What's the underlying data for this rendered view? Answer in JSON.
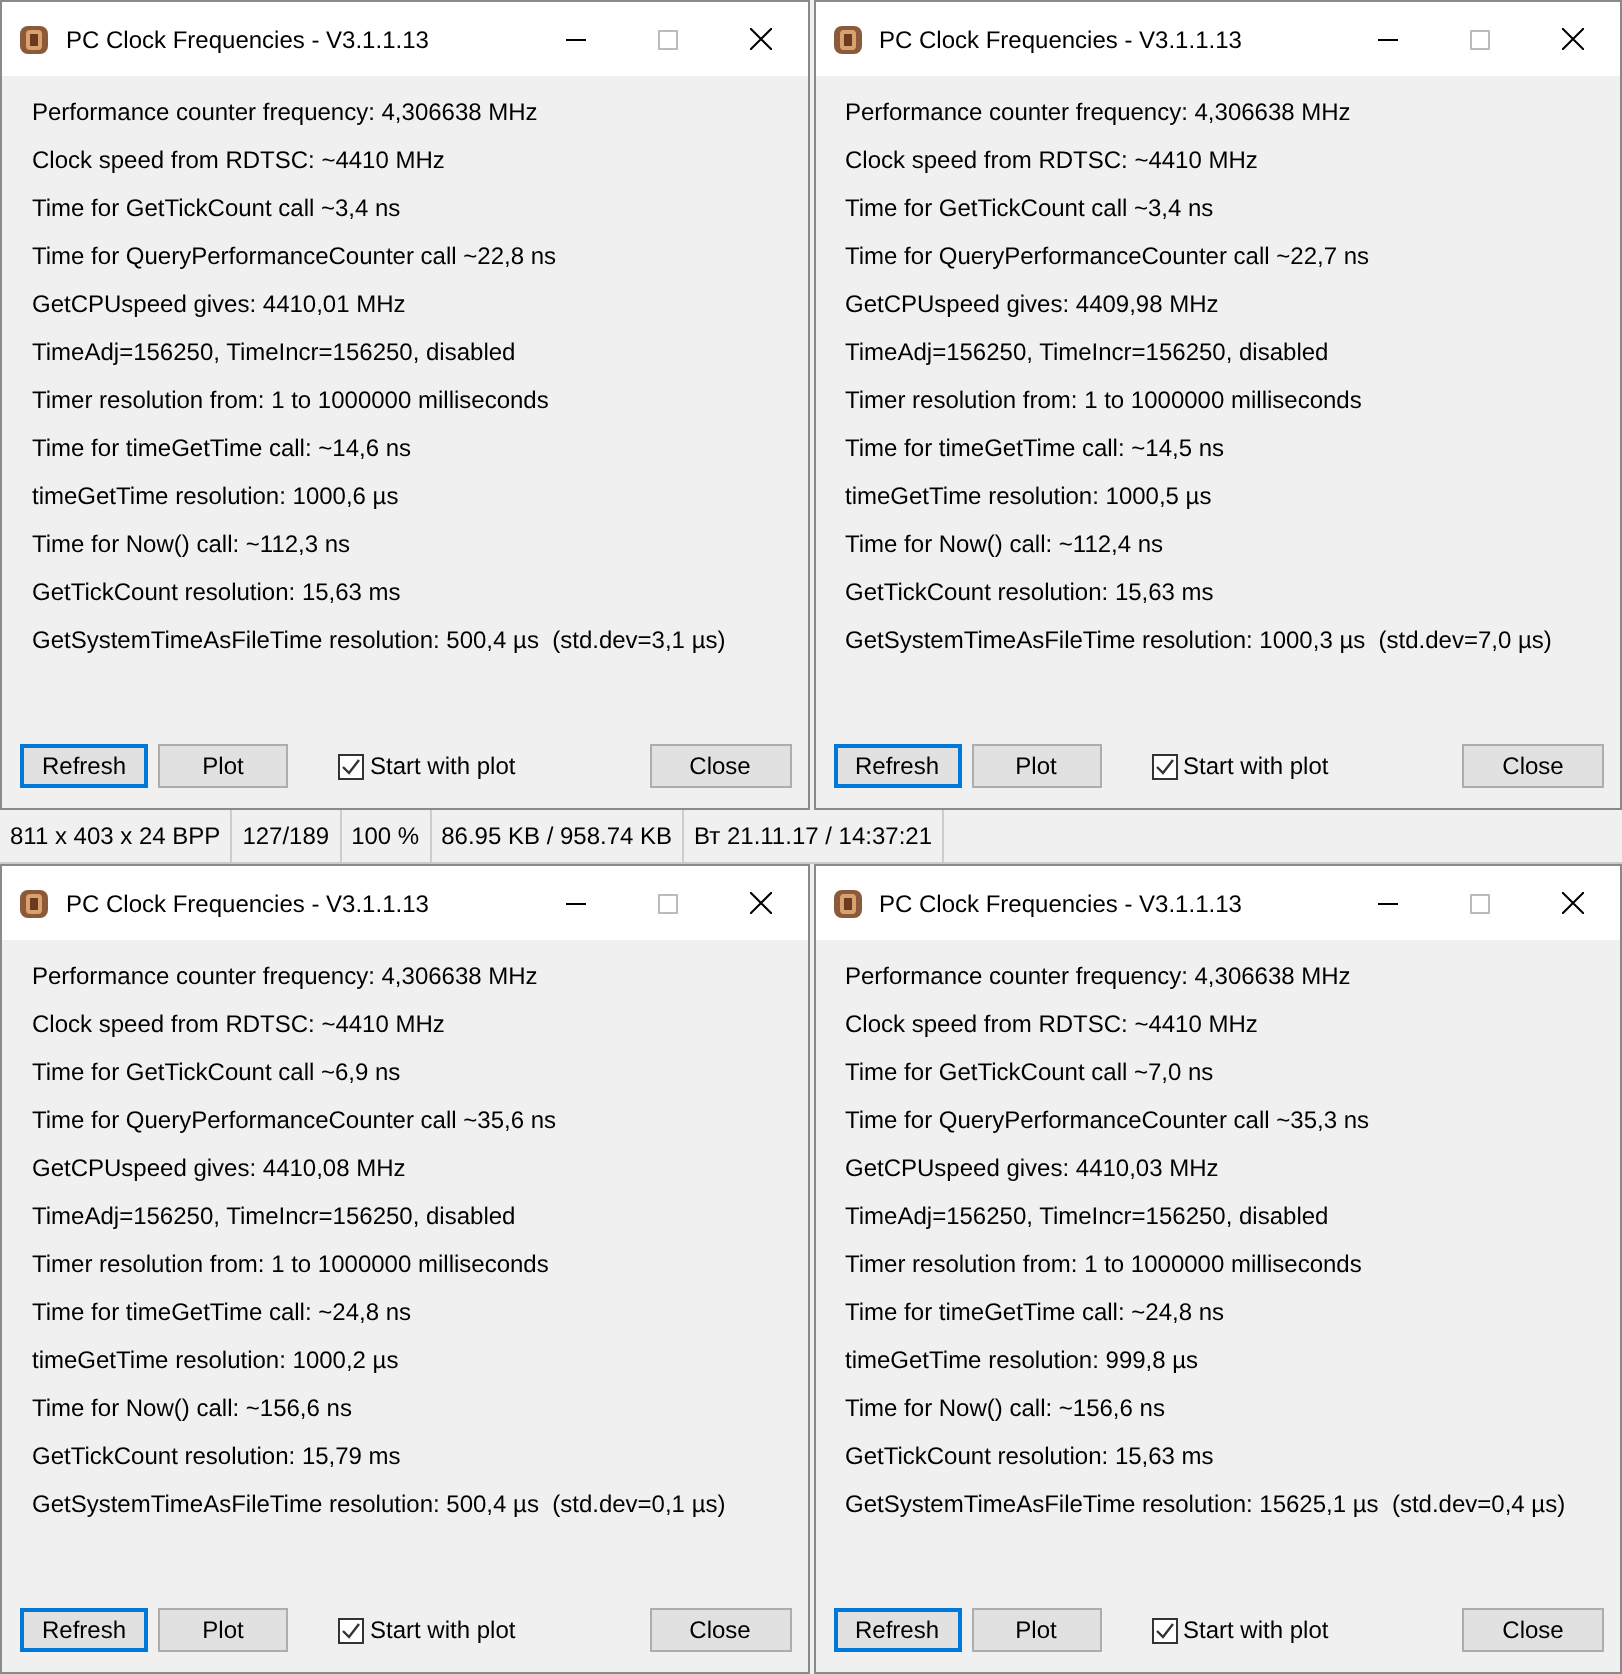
{
  "windows": [
    {
      "title": "PC Clock Frequencies - V3.1.1.13",
      "lines": [
        "Performance counter frequency: 4,306638 MHz",
        "Clock speed from RDTSC: ~4410 MHz",
        "Time for GetTickCount call ~3,4 ns",
        "Time for QueryPerformanceCounter call ~22,8 ns",
        "GetCPUspeed gives: 4410,01 MHz",
        "TimeAdj=156250, TimeIncr=156250, disabled",
        "Timer resolution from: 1 to 1000000 milliseconds",
        "Time for timeGetTime call: ~14,6 ns",
        "timeGetTime resolution: 1000,6 µs",
        "Time for Now() call: ~112,3 ns",
        "GetTickCount resolution: 15,63 ms",
        "GetSystemTimeAsFileTime resolution: 500,4 µs  (std.dev=3,1 µs)"
      ],
      "refresh": "Refresh",
      "plot": "Plot",
      "start_with_plot": {
        "label": "Start with plot",
        "checked": true
      },
      "close": "Close"
    },
    {
      "title": "PC Clock Frequencies - V3.1.1.13",
      "lines": [
        "Performance counter frequency: 4,306638 MHz",
        "Clock speed from RDTSC: ~4410 MHz",
        "Time for GetTickCount call ~3,4 ns",
        "Time for QueryPerformanceCounter call ~22,7 ns",
        "GetCPUspeed gives: 4409,98 MHz",
        "TimeAdj=156250, TimeIncr=156250, disabled",
        "Timer resolution from: 1 to 1000000 milliseconds",
        "Time for timeGetTime call: ~14,5 ns",
        "timeGetTime resolution: 1000,5 µs",
        "Time for Now() call: ~112,4 ns",
        "GetTickCount resolution: 15,63 ms",
        "GetSystemTimeAsFileTime resolution: 1000,3 µs  (std.dev=7,0 µs)"
      ],
      "refresh": "Refresh",
      "plot": "Plot",
      "start_with_plot": {
        "label": "Start with plot",
        "checked": true
      },
      "close": "Close"
    }
  ],
  "status_bar": [
    "811 x 403 x 24 BPP",
    "127/189",
    "100 %",
    "86.95 KB / 958.74 KB",
    "Вт 21.11.17 / 14:37:21"
  ],
  "windows_bottom": [
    {
      "title": "PC Clock Frequencies - V3.1.1.13",
      "lines": [
        "Performance counter frequency: 4,306638 MHz",
        "Clock speed from RDTSC: ~4410 MHz",
        "Time for GetTickCount call ~6,9 ns",
        "Time for QueryPerformanceCounter call ~35,6 ns",
        "GetCPUspeed gives: 4410,08 MHz",
        "TimeAdj=156250, TimeIncr=156250, disabled",
        "Timer resolution from: 1 to 1000000 milliseconds",
        "Time for timeGetTime call: ~24,8 ns",
        "timeGetTime resolution: 1000,2 µs",
        "Time for Now() call: ~156,6 ns",
        "GetTickCount resolution: 15,79 ms",
        "GetSystemTimeAsFileTime resolution: 500,4 µs  (std.dev=0,1 µs)"
      ],
      "refresh": "Refresh",
      "plot": "Plot",
      "start_with_plot": {
        "label": "Start with plot",
        "checked": true
      },
      "close": "Close"
    },
    {
      "title": "PC Clock Frequencies - V3.1.1.13",
      "lines": [
        "Performance counter frequency: 4,306638 MHz",
        "Clock speed from RDTSC: ~4410 MHz",
        "Time for GetTickCount call ~7,0 ns",
        "Time for QueryPerformanceCounter call ~35,3 ns",
        "GetCPUspeed gives: 4410,03 MHz",
        "TimeAdj=156250, TimeIncr=156250, disabled",
        "Timer resolution from: 1 to 1000000 milliseconds",
        "Time for timeGetTime call: ~24,8 ns",
        "timeGetTime resolution: 999,8 µs",
        "Time for Now() call: ~156,6 ns",
        "GetTickCount resolution: 15,63 ms",
        "GetSystemTimeAsFileTime resolution: 15625,1 µs  (std.dev=0,4 µs)"
      ],
      "refresh": "Refresh",
      "plot": "Plot",
      "start_with_plot": {
        "label": "Start with plot",
        "checked": true
      },
      "close": "Close"
    }
  ]
}
